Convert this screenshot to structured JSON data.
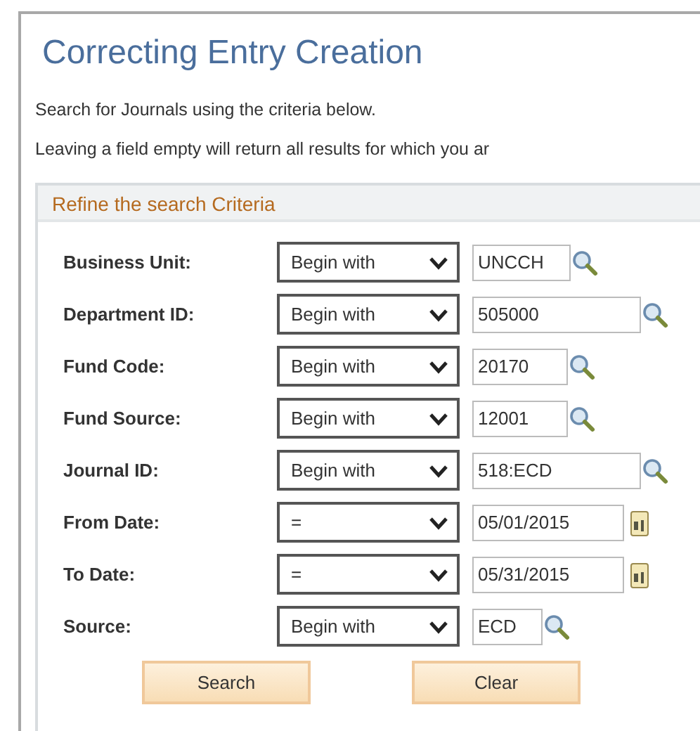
{
  "title": "Correcting Entry Creation",
  "instructions": [
    "Search for Journals using the criteria below.",
    "Leaving a field empty will return all results for which you ar"
  ],
  "panel": {
    "header": "Refine the search Criteria",
    "fields": [
      {
        "label": "Business Unit:",
        "operator": "Begin with",
        "value": "UNCCH",
        "kind": "lookup"
      },
      {
        "label": "Department ID:",
        "operator": "Begin with",
        "value": "505000",
        "kind": "lookup"
      },
      {
        "label": "Fund Code:",
        "operator": "Begin with",
        "value": "20170",
        "kind": "lookup"
      },
      {
        "label": "Fund Source:",
        "operator": "Begin with",
        "value": "12001",
        "kind": "lookup"
      },
      {
        "label": "Journal ID:",
        "operator": "Begin with",
        "value": "518:ECD",
        "kind": "lookup"
      },
      {
        "label": "From Date:",
        "operator": "=",
        "value": "05/01/2015",
        "kind": "date"
      },
      {
        "label": "To Date:",
        "operator": "=",
        "value": "05/31/2015",
        "kind": "date"
      },
      {
        "label": "Source:",
        "operator": "Begin with",
        "value": "ECD",
        "kind": "lookup"
      }
    ],
    "buttons": [
      "Search",
      "Clear"
    ]
  }
}
